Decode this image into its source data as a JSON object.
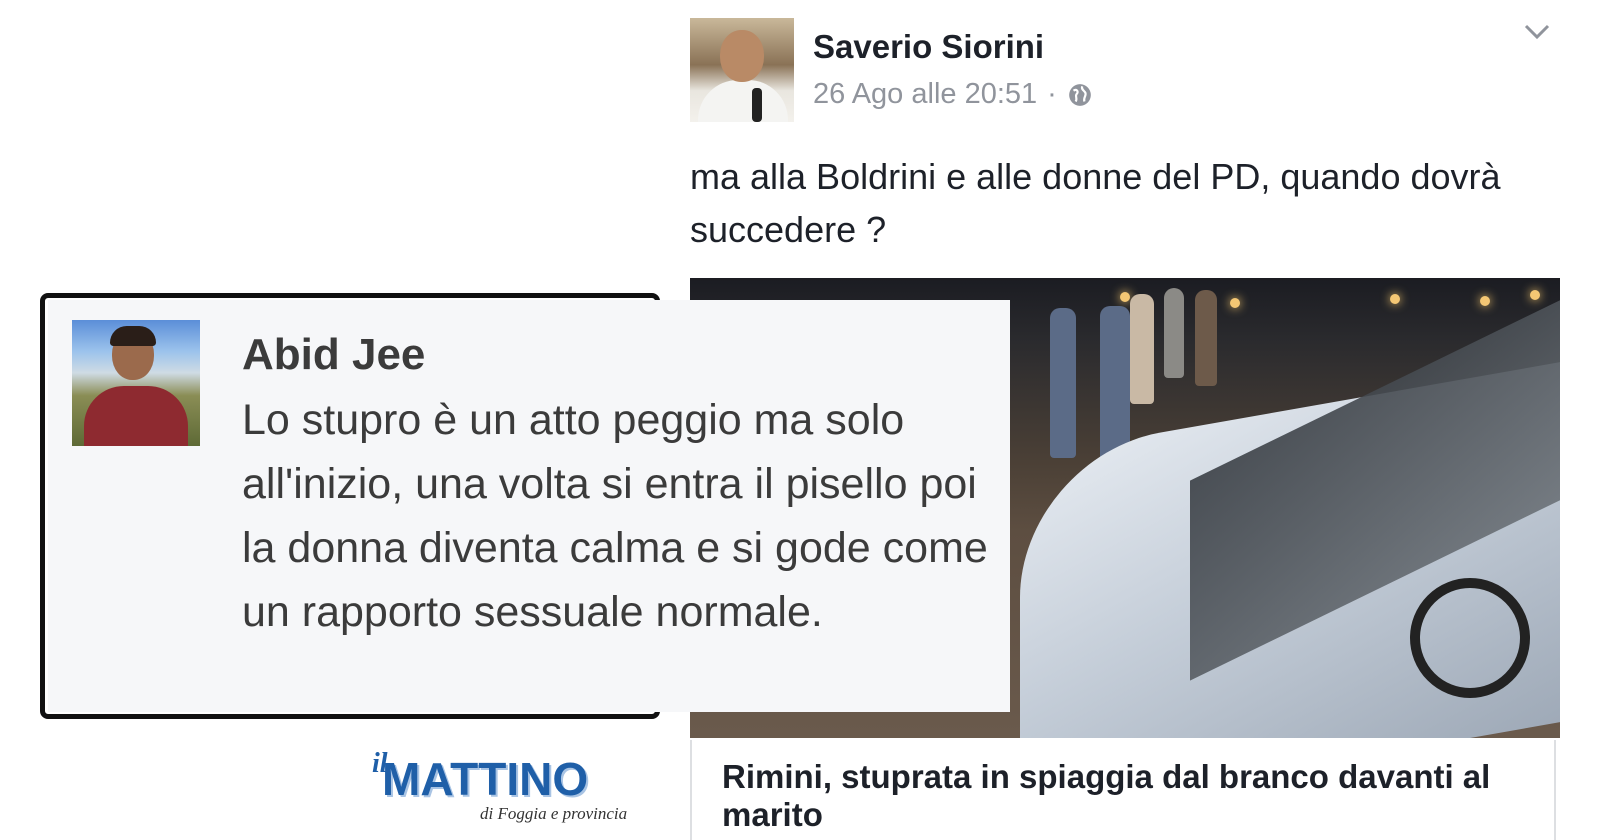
{
  "post": {
    "author": "Saverio Siorini",
    "timestamp": "26 Ago alle 20:51",
    "separator": "·",
    "privacy_icon": "globe-icon",
    "menu_icon": "chevron-down-icon",
    "text": "ma alla Boldrini e alle donne del PD, quando dovrà succedere ?",
    "link_title": "Rimini, stuprata in spiaggia dal branco davanti al marito"
  },
  "comment": {
    "author": "Abid Jee",
    "text": "Lo stupro è un atto peggio ma solo all'inizio, una volta si entra il pisello poi la donna diventa calma e si gode come un rapporto sessuale normale."
  },
  "logo": {
    "prefix": "il",
    "name": "MATTINO",
    "subtitle": "di Foggia e provincia"
  },
  "colors": {
    "name_text": "#1d2129",
    "meta_text": "#90949c",
    "logo_blue": "#1f5fa8",
    "comment_text": "#3b3b3b",
    "comment_bg": "#f6f7f9"
  }
}
